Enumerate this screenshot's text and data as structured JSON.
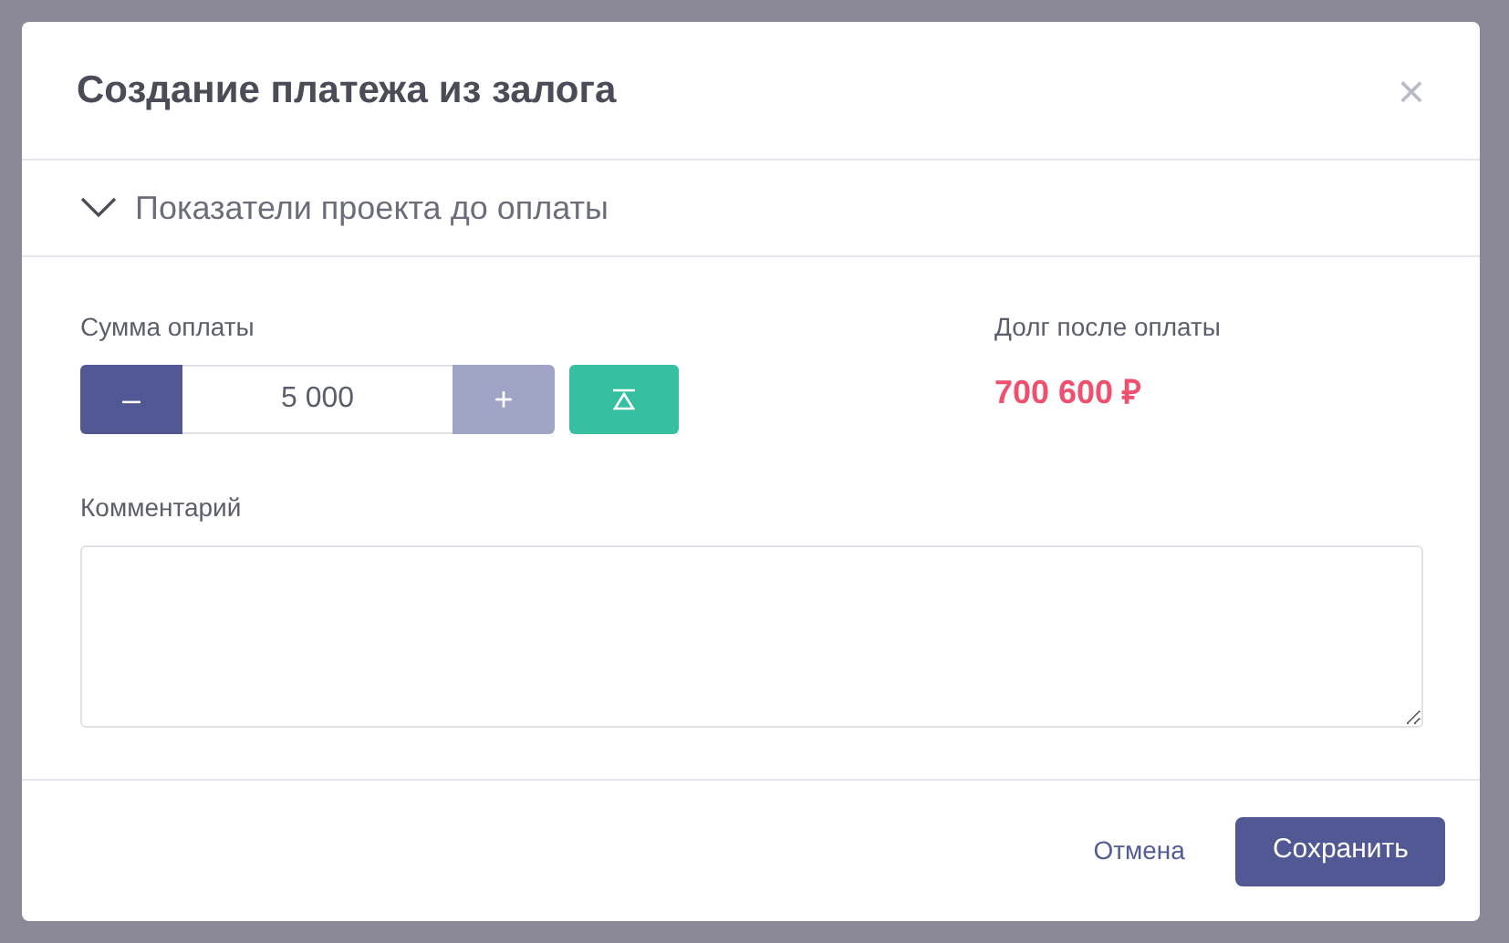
{
  "dialog": {
    "title": "Создание платежа из залога",
    "close_label": "×"
  },
  "section": {
    "label": "Показатели проекта до оплаты",
    "expanded": false
  },
  "payment": {
    "label": "Сумма оплаты",
    "value": "5 000",
    "minus": {
      "label": "–",
      "disabled": false
    },
    "plus": {
      "label": "+",
      "disabled": true
    }
  },
  "debt": {
    "label": "Долг после оплаты",
    "value": "700 600 ₽"
  },
  "comment": {
    "label": "Комментарий"
  },
  "buttons": {
    "cancel": "Отмена",
    "save": "Сохранить"
  }
}
